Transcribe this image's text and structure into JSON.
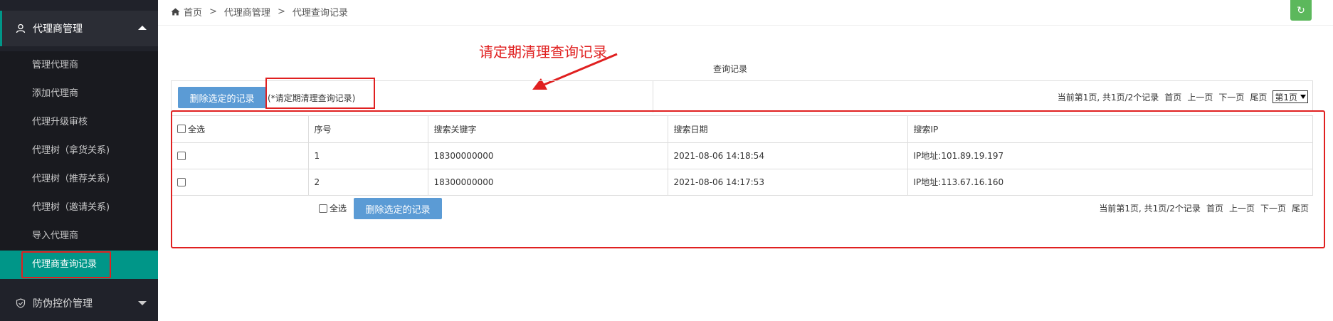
{
  "sidebar": {
    "group_open": "代理商管理",
    "items": [
      {
        "label": "管理代理商"
      },
      {
        "label": "添加代理商"
      },
      {
        "label": "代理升级审核"
      },
      {
        "label": "代理树（拿货关系)"
      },
      {
        "label": "代理树（推荐关系)"
      },
      {
        "label": "代理树（邀请关系)"
      },
      {
        "label": "导入代理商"
      },
      {
        "label": "代理商查询记录"
      }
    ],
    "group_closed": "防伪控价管理"
  },
  "breadcrumb": [
    "首页",
    "代理商管理",
    "代理查询记录"
  ],
  "breadcrumb_sep": ">",
  "annotation": "请定期清理查询记录",
  "page_title": "查询记录",
  "toolbar": {
    "delete_label": "删除选定的记录",
    "hint": "(*请定期清理查询记录)"
  },
  "pager": {
    "status": "当前第1页, 共1页/2个记录",
    "first": "首页",
    "prev": "上一页",
    "next": "下一页",
    "last": "尾页",
    "select_value": "第1页"
  },
  "table": {
    "headers": [
      "全选",
      "序号",
      "搜索关键字",
      "搜索日期",
      "搜索IP"
    ],
    "rows": [
      {
        "index": "1",
        "keyword": "18300000000",
        "date": "2021-08-06 14:18:54",
        "ip": "IP地址:101.89.19.197"
      },
      {
        "index": "2",
        "keyword": "18300000000",
        "date": "2021-08-06 14:17:53",
        "ip": "IP地址:113.67.16.160"
      }
    ]
  },
  "bottom": {
    "select_all": "全选",
    "delete_label": "删除选定的记录"
  },
  "colors": {
    "accent": "#009688",
    "sidebar": "#20222a",
    "annotation": "#e02020",
    "button": "#5b9bd5",
    "refresh": "#5cb85c"
  }
}
